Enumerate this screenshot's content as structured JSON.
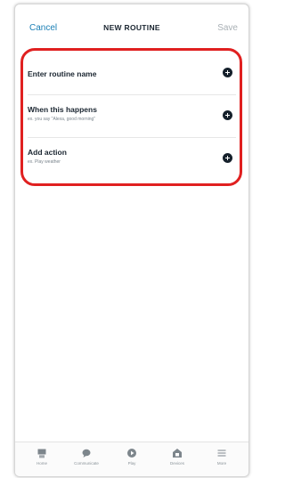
{
  "header": {
    "cancel_label": "Cancel",
    "title": "NEW ROUTINE",
    "save_label": "Save"
  },
  "rows": [
    {
      "label": "Enter routine name",
      "sub": ""
    },
    {
      "label": "When this happens",
      "sub": "ex. you say \"Alexa, good morning\""
    },
    {
      "label": "Add action",
      "sub": "ex. Play weather"
    }
  ],
  "nav": [
    {
      "label": "Home",
      "icon": "home-icon"
    },
    {
      "label": "Communicate",
      "icon": "chat-bubble-icon"
    },
    {
      "label": "Play",
      "icon": "play-icon"
    },
    {
      "label": "Devices",
      "icon": "devices-icon"
    },
    {
      "label": "More",
      "icon": "menu-icon"
    }
  ],
  "colors": {
    "accent": "#1a7fb5",
    "highlight": "#e02020"
  }
}
